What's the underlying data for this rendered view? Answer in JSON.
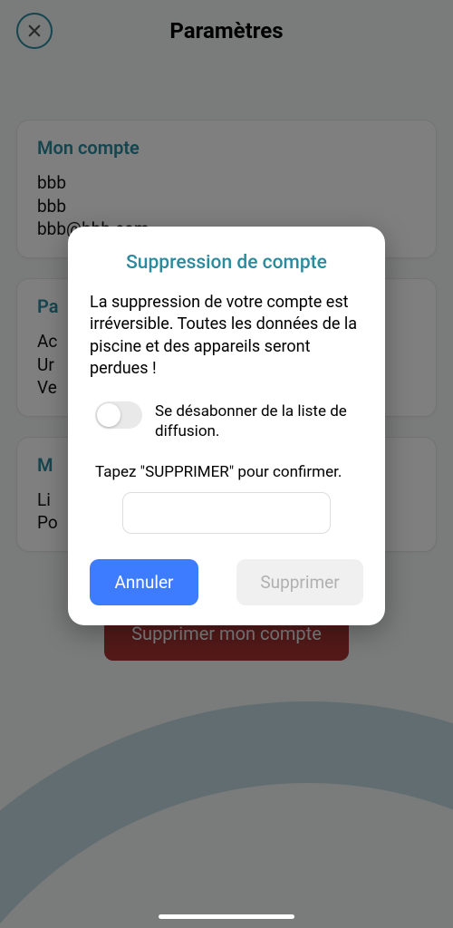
{
  "header": {
    "title": "Paramètres"
  },
  "accountCard": {
    "title": "Mon compte",
    "line1": "bbb",
    "line2": "bbb",
    "line3": "bbb@bbb.com"
  },
  "card2": {
    "title": "Pa",
    "line1": "Ac",
    "line2": "Ur",
    "line3": "Ve"
  },
  "card3": {
    "title": "M",
    "line1": "Li",
    "line2": "Po"
  },
  "deleteAccountButton": "Supprimer mon compte",
  "modal": {
    "title": "Suppression de compte",
    "body": "La suppression de votre compte est irréversible. Toutes les données de la piscine et des appareils seront perdues !",
    "unsubscribeLabel": "Se désabonner de la liste de diffusion.",
    "confirmPrompt": "Tapez \"SUPPRIMER\" pour confirmer.",
    "confirmValue": "",
    "cancel": "Annuler",
    "delete": "Supprimer"
  }
}
